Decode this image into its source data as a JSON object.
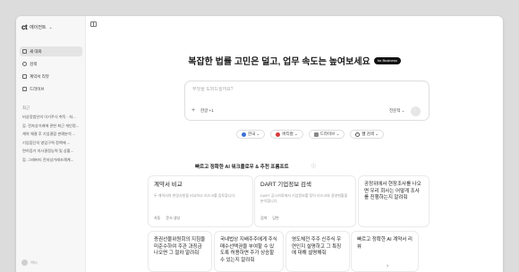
{
  "brand": {
    "logo": "ct",
    "name": "에이전트"
  },
  "sidebar": {
    "items": [
      {
        "label": "새 대화"
      },
      {
        "label": "검색"
      },
      {
        "label": "계약서 리뷰"
      },
      {
        "label": "드라이브"
      }
    ],
    "recent_title": "최근",
    "recent": [
      "비상장법인의 이기주식 취득 · 처...",
      "갑. 전자상거래에 관한 최근 개인정...",
      "계약 체결 후 기업결합 판례분석 ...",
      "기업집단의 영업구역 정책에 ...",
      "면허증가 의사결정능력 및 상황...",
      "갑. 그래버티 전자상거래조례계..."
    ],
    "user_name": "엑터"
  },
  "main": {
    "headline": "복잡한 법률 고민은 덜고, 업무 속도는 높여보세요",
    "badge": "for Business",
    "prompt_placeholder": "무엇을 도와드릴까요?",
    "prompt_lang": "한글 +1",
    "prompt_mode": "전문적 ⌄",
    "chips": [
      {
        "label": "한국 ⌄",
        "color": "#3b6fd6"
      },
      {
        "label": "버티컬 ⌄",
        "color": "#d63b3b"
      },
      {
        "label": "드라이브 ⌄",
        "color": "#888888"
      },
      {
        "label": "웹 검색 ⌄",
        "color": "#555555"
      }
    ],
    "section_title": "빠르고 정확한 AI 워크플로우 & 추천 프롬프트",
    "section_info": "ⓘ",
    "cards_top": [
      {
        "title": "계약서 비교",
        "desc": "두 계약서의 변경사항을 비교하고 리스크를 검토합니다.",
        "meta": [
          "자동",
          "문서 생성"
        ]
      },
      {
        "title": "DART 기업정보 검색",
        "desc": "DART 공시자료에서 기업정보를 찾아 리스크와 경영현황을 분석합니다.",
        "meta": [
          "검색",
          "답변"
        ]
      },
      {
        "title": "공정위에서 현장조사를 나오면 우리 회사는 어떻게 조사를 진행하는지 알려줘",
        "desc": "",
        "meta": []
      }
    ],
    "cards_bottom": [
      {
        "title": "증권선물위원회의 지침을 미준수하여 주관 과징금 나오면 그 절차 알려줘"
      },
      {
        "title": "국내법상 지배주주에게 주식매수선택권을 부여할 수 있도록 허용하면 주가 상승할 수 있는지 알려줘"
      },
      {
        "title": "영도체전 주주 신주식 우연인지 설명하고 그 특징에 대해 설명해줘"
      },
      {
        "title": "빠르고 정확한 AI 계약서 리뷰"
      }
    ]
  }
}
